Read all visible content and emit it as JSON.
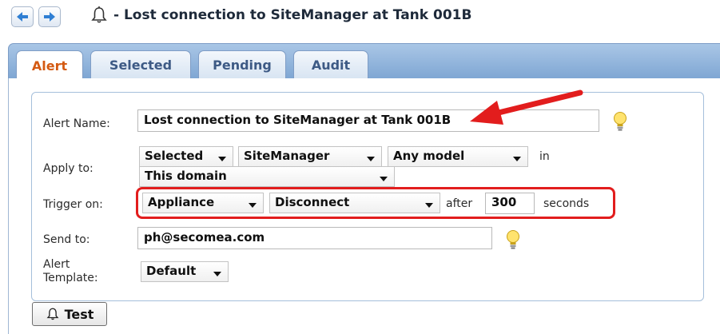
{
  "header": {
    "title": "- Lost connection to SiteManager at Tank 001B",
    "back_icon": "arrow-left-icon",
    "forward_icon": "arrow-right-icon",
    "bell_icon": "bell-icon"
  },
  "tabs": [
    {
      "label": "Alert",
      "active": true
    },
    {
      "label": "Selected",
      "active": false
    },
    {
      "label": "Pending",
      "active": false
    },
    {
      "label": "Audit",
      "active": false
    }
  ],
  "form": {
    "alert_name": {
      "label": "Alert Name:",
      "value": "Lost connection to SiteManager at Tank 001B"
    },
    "apply_to": {
      "label": "Apply to:",
      "selects": [
        "Selected",
        "SiteManager",
        "Any model"
      ],
      "in_text": "in",
      "domain_select": "This domain"
    },
    "trigger_on": {
      "label": "Trigger on:",
      "type_select": "Appliance",
      "event_select": "Disconnect",
      "after_text": "after",
      "seconds_value": "300",
      "seconds_text": "seconds"
    },
    "send_to": {
      "label": "Send to:",
      "value": "ph@secomea.com"
    },
    "template": {
      "label_line1": "Alert",
      "label_line2": "Template:",
      "select": "Default"
    }
  },
  "test_button": {
    "label": "Test"
  },
  "colors": {
    "accent_red": "#e21d1d",
    "tab_active_text": "#d45a12",
    "tab_band": "#8fb2db"
  }
}
